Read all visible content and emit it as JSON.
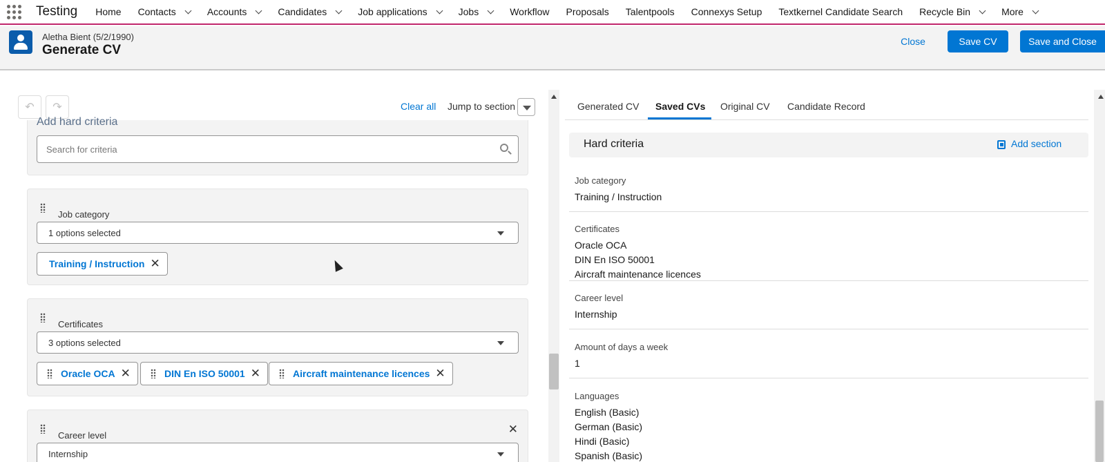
{
  "nav": {
    "app_name": "Testing",
    "items": [
      {
        "label": "Home",
        "dropdown": false
      },
      {
        "label": "Contacts",
        "dropdown": true
      },
      {
        "label": "Accounts",
        "dropdown": true
      },
      {
        "label": "Candidates",
        "dropdown": true
      },
      {
        "label": "Job applications",
        "dropdown": true
      },
      {
        "label": "Jobs",
        "dropdown": true
      },
      {
        "label": "Workflow",
        "dropdown": false
      },
      {
        "label": "Proposals",
        "dropdown": false
      },
      {
        "label": "Talentpools",
        "dropdown": false
      },
      {
        "label": "Connexys Setup",
        "dropdown": false
      },
      {
        "label": "Textkernel Candidate Search",
        "dropdown": false
      },
      {
        "label": "Recycle Bin",
        "dropdown": true
      },
      {
        "label": "More",
        "dropdown": true
      }
    ]
  },
  "header": {
    "record_subtitle": "Aletha Bient (5/2/1990)",
    "record_title": "Generate CV",
    "close_label": "Close",
    "save_cv_label": "Save CV",
    "save_close_label": "Save and Close"
  },
  "toolbar": {
    "clear_all": "Clear all",
    "jump_to_section": "Jump to section"
  },
  "editor": {
    "add_hard_criteria": "Add hard criteria",
    "search_placeholder": "Search for criteria",
    "job_category": {
      "label": "Job category",
      "selection": "1 options selected",
      "pills": [
        "Training / Instruction"
      ]
    },
    "certificates": {
      "label": "Certificates",
      "selection": "3 options selected",
      "pills": [
        "Oracle OCA",
        "DIN En ISO 50001",
        "Aircraft maintenance licences"
      ]
    },
    "career_level": {
      "label": "Career level",
      "selection": "Internship"
    }
  },
  "preview": {
    "tabs": [
      "Generated CV",
      "Saved CVs",
      "Original CV",
      "Candidate Record"
    ],
    "active_tab": "Saved CVs",
    "section_title": "Hard criteria",
    "add_section": "Add section",
    "fields": {
      "job_category": {
        "label": "Job category",
        "values": [
          "Training / Instruction"
        ]
      },
      "certificates": {
        "label": "Certificates",
        "values": [
          "Oracle OCA",
          "DIN En ISO 50001",
          "Aircraft maintenance licences"
        ]
      },
      "career_level": {
        "label": "Career level",
        "values": [
          "Internship"
        ]
      },
      "days_a_week": {
        "label": "Amount of days a week",
        "values": [
          "1"
        ]
      },
      "languages": {
        "label": "Languages",
        "values": [
          "English  (Basic)",
          "German  (Basic)",
          "Hindi  (Basic)",
          "Spanish  (Basic)"
        ]
      }
    }
  },
  "colors": {
    "brand": "#0176d3",
    "nav_accent": "#c0266b",
    "record_icon": "#0b5cab"
  }
}
